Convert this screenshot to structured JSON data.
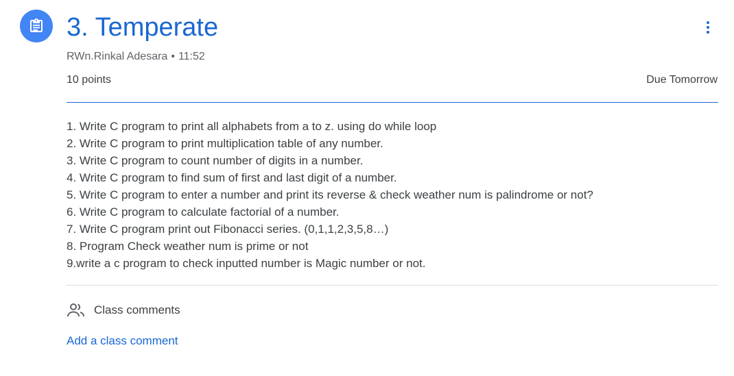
{
  "header": {
    "title": "3. Temperate",
    "author": "RWn.Rinkal Adesara",
    "separator": "•",
    "time": "11:52",
    "points": "10 points",
    "due": "Due Tomorrow"
  },
  "icons": {
    "assignment": "assignment-clipboard-icon",
    "more": "more-vert-icon",
    "comments": "people-icon"
  },
  "instructions": [
    "1. Write C program to print all alphabets from a to z. using do while loop",
    "2. Write C program to print multiplication table of any number.",
    "3. Write C program to count number of digits in a number.",
    "4. Write C program to find sum of first and last digit of a number.",
    "5. Write C program to enter a number and print its reverse & check weather num is palindrome or not?",
    "6. Write C program to calculate factorial of a number.",
    "7. Write C program print out Fibonacci series. (0,1,1,2,3,5,8…)",
    "8. Program Check weather num is prime or not",
    "9.write a c program to check inputted number is Magic number or not."
  ],
  "comments": {
    "header": "Class comments",
    "add_link": "Add a class comment"
  },
  "colors": {
    "accent": "#1967d2",
    "icon_bg": "#4285f4",
    "text": "#3c4043",
    "secondary_text": "#5f6368",
    "divider": "#dadce0"
  }
}
